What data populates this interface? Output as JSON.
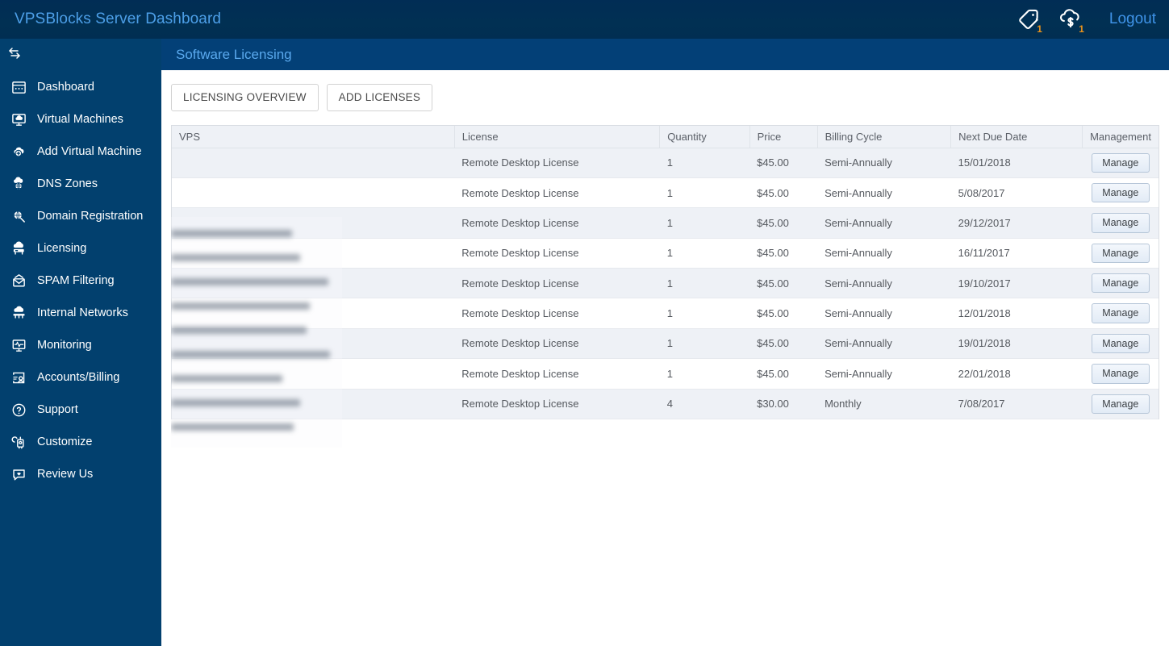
{
  "topbar": {
    "app_title": "VPSBlocks Server Dashboard",
    "icons": [
      {
        "name": "tag-icon",
        "badge": "1"
      },
      {
        "name": "cloud-dollar-icon",
        "badge": "1"
      }
    ],
    "logout_label": "Logout",
    "accent_color": "#4d9fe8",
    "badge_color": "#e8921b",
    "background_color": "#012d55"
  },
  "sidebar": {
    "background_color": "#02406e",
    "toggle_icon": "collapse-expand-arrows-icon",
    "items": [
      {
        "label": "Dashboard",
        "icon": "dashboard-icon"
      },
      {
        "label": "Virtual Machines",
        "icon": "monitor-cloud-icon"
      },
      {
        "label": "Add Virtual Machine",
        "icon": "cloud-plus-icon"
      },
      {
        "label": "DNS Zones",
        "icon": "globe-cloud-icon"
      },
      {
        "label": "Domain Registration",
        "icon": "magnifier-globe-icon"
      },
      {
        "label": "Licensing",
        "icon": "server-license-icon"
      },
      {
        "label": "SPAM Filtering",
        "icon": "mail-filter-icon"
      },
      {
        "label": "Internal Networks",
        "icon": "network-cloud-icon"
      },
      {
        "label": "Monitoring",
        "icon": "heartbeat-monitor-icon"
      },
      {
        "label": "Accounts/Billing",
        "icon": "account-billing-icon"
      },
      {
        "label": "Support",
        "icon": "question-circle-icon"
      },
      {
        "label": "Customize",
        "icon": "customize-gear-icon"
      },
      {
        "label": "Review Us",
        "icon": "chat-heart-icon"
      }
    ],
    "collapse_handle_icon": "collapse-left-triangle-icon"
  },
  "page": {
    "header_title": "Software Licensing",
    "header_background": "#034077",
    "header_text_color": "#5aa9ee"
  },
  "toolbar": {
    "licensing_overview_label": "LICENSING OVERVIEW",
    "add_licenses_label": "ADD LICENSES"
  },
  "table": {
    "columns": [
      "VPS",
      "License",
      "Quantity",
      "Price",
      "Billing Cycle",
      "Next Due Date",
      "Management"
    ],
    "manage_label": "Manage",
    "rows": [
      {
        "vps": "",
        "license": "Remote Desktop License",
        "quantity": "1",
        "price": "$45.00",
        "billing_cycle": "Semi-Annually",
        "next_due_date": "15/01/2018"
      },
      {
        "vps": "",
        "license": "Remote Desktop License",
        "quantity": "1",
        "price": "$45.00",
        "billing_cycle": "Semi-Annually",
        "next_due_date": "5/08/2017"
      },
      {
        "vps": "",
        "license": "Remote Desktop License",
        "quantity": "1",
        "price": "$45.00",
        "billing_cycle": "Semi-Annually",
        "next_due_date": "29/12/2017"
      },
      {
        "vps": "",
        "license": "Remote Desktop License",
        "quantity": "1",
        "price": "$45.00",
        "billing_cycle": "Semi-Annually",
        "next_due_date": "16/11/2017"
      },
      {
        "vps": "",
        "license": "Remote Desktop License",
        "quantity": "1",
        "price": "$45.00",
        "billing_cycle": "Semi-Annually",
        "next_due_date": "19/10/2017"
      },
      {
        "vps": "",
        "license": "Remote Desktop License",
        "quantity": "1",
        "price": "$45.00",
        "billing_cycle": "Semi-Annually",
        "next_due_date": "12/01/2018"
      },
      {
        "vps": "",
        "license": "Remote Desktop License",
        "quantity": "1",
        "price": "$45.00",
        "billing_cycle": "Semi-Annually",
        "next_due_date": "19/01/2018"
      },
      {
        "vps": "",
        "license": "Remote Desktop License",
        "quantity": "1",
        "price": "$45.00",
        "billing_cycle": "Semi-Annually",
        "next_due_date": "22/01/2018"
      },
      {
        "vps": "",
        "license": "Remote Desktop License",
        "quantity": "4",
        "price": "$30.00",
        "billing_cycle": "Monthly",
        "next_due_date": "7/08/2017"
      }
    ],
    "vps_column_redacted": true,
    "redacted_row_widths": [
      150,
      160,
      195,
      172,
      168,
      197,
      138,
      160,
      152
    ]
  }
}
